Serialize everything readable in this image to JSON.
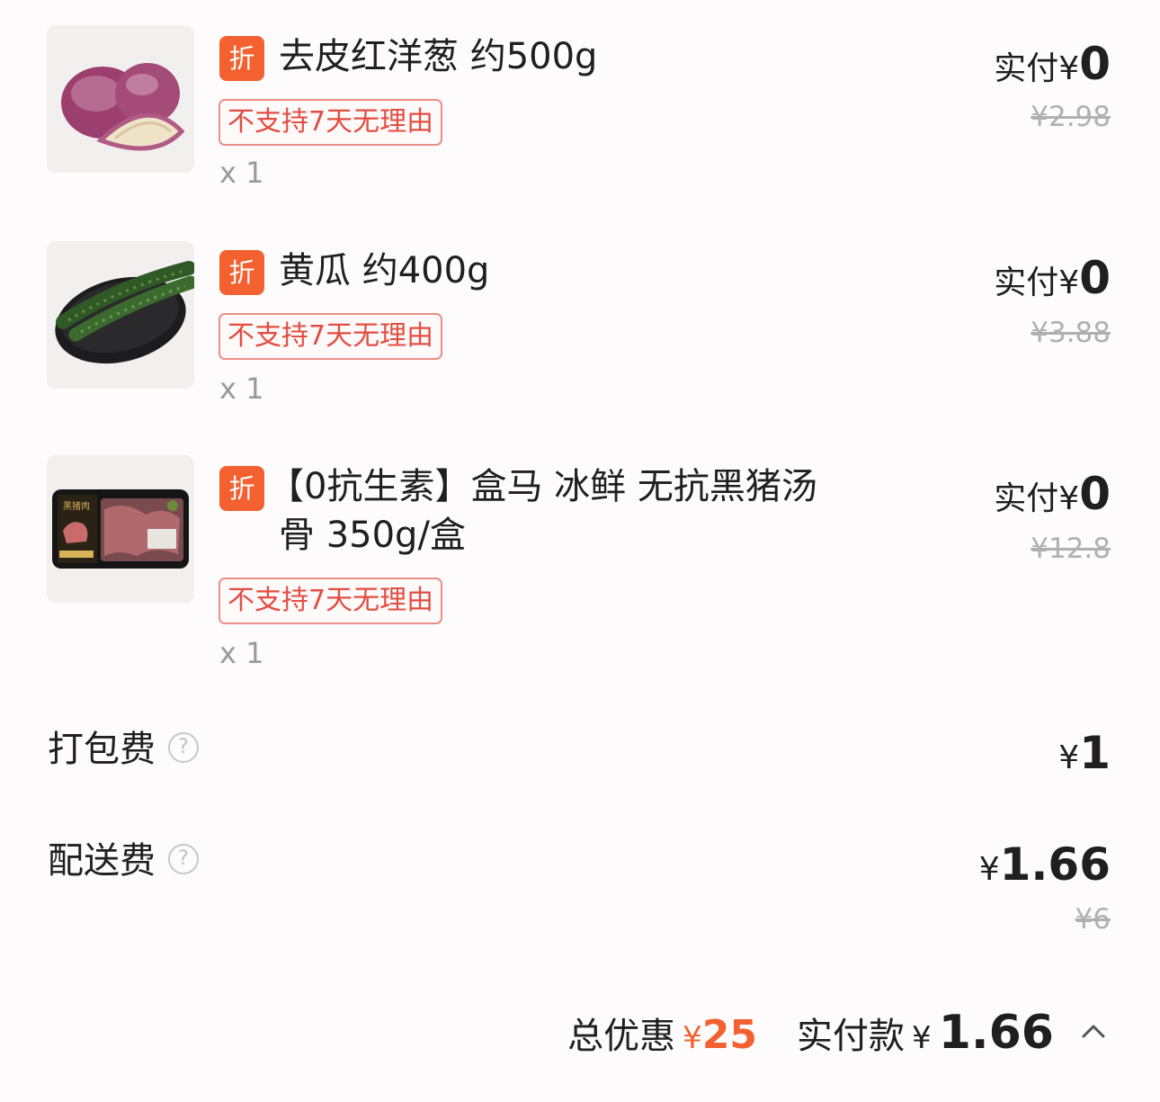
{
  "items": [
    {
      "discount_badge": "折",
      "name_line1": "去皮红洋葱 约500g",
      "name_line2": "",
      "tag": "不支持7天无理由",
      "qty": "x 1",
      "paid_label": "实付¥",
      "paid_value": "0",
      "original_price": "¥2.98",
      "image": "red-onion-image"
    },
    {
      "discount_badge": "折",
      "name_line1": "黄瓜 约400g",
      "name_line2": "",
      "tag": "不支持7天无理由",
      "qty": "x 1",
      "paid_label": "实付¥",
      "paid_value": "0",
      "original_price": "¥3.88",
      "image": "cucumber-image"
    },
    {
      "discount_badge": "折",
      "name_line1": "【0抗生素】盒马 冰鲜 无抗黑猪汤",
      "name_line2": "骨 350g/盒",
      "tag": "不支持7天无理由",
      "qty": "x 1",
      "paid_label": "实付¥",
      "paid_value": "0",
      "original_price": "¥12.8",
      "image": "pork-bone-package-image"
    }
  ],
  "fees": {
    "packing": {
      "label": "打包费",
      "help": "?",
      "value_sym": "¥",
      "value": "1"
    },
    "delivery": {
      "label": "配送费",
      "help": "?",
      "value_sym": "¥",
      "value": "1.66",
      "original": "¥6"
    }
  },
  "footer": {
    "discount_label": "总优惠",
    "discount_sym": "¥",
    "discount_value": "25",
    "paid_label": "实付款",
    "paid_sym": "¥",
    "paid_value": "1.66",
    "expand_icon": "chevron-up-icon"
  },
  "colors": {
    "accent": "#f2612f",
    "tag_text": "#e24d42",
    "tag_border": "#ea8e87",
    "muted": "#9a9a9a",
    "strike": "#b0b0b0"
  }
}
